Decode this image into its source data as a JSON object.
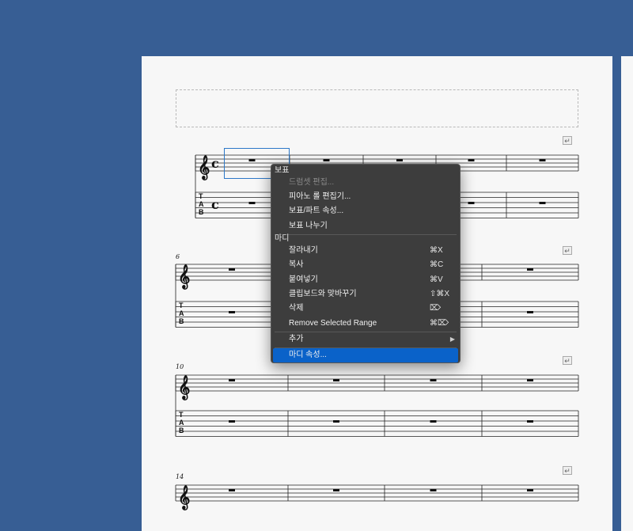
{
  "score": {
    "measure_numbers": [
      "6",
      "10",
      "14"
    ],
    "time_signature": "c",
    "tab_label": "TAB",
    "return_mark": "↵"
  },
  "context_menu": {
    "section_score": "보표",
    "item_drumset": "드럼셋 편집...",
    "item_pianoroll": "피아노 롤 편집기...",
    "item_staffprops": "보표/파트 속성...",
    "item_split": "보표 나누기",
    "section_measure": "마디",
    "item_cut": "잘라내기",
    "sc_cut": "⌘X",
    "item_copy": "복사",
    "sc_copy": "⌘C",
    "item_paste": "붙여넣기",
    "sc_paste": "⌘V",
    "item_swap": "클립보드와 맞바꾸기",
    "sc_swap": "⇧⌘X",
    "item_delete": "삭제",
    "sc_delete": "⌦",
    "item_remove_range": "Remove Selected Range",
    "sc_remove_range": "⌘⌦",
    "item_add": "추가",
    "item_measureprops": "마디 속성..."
  }
}
